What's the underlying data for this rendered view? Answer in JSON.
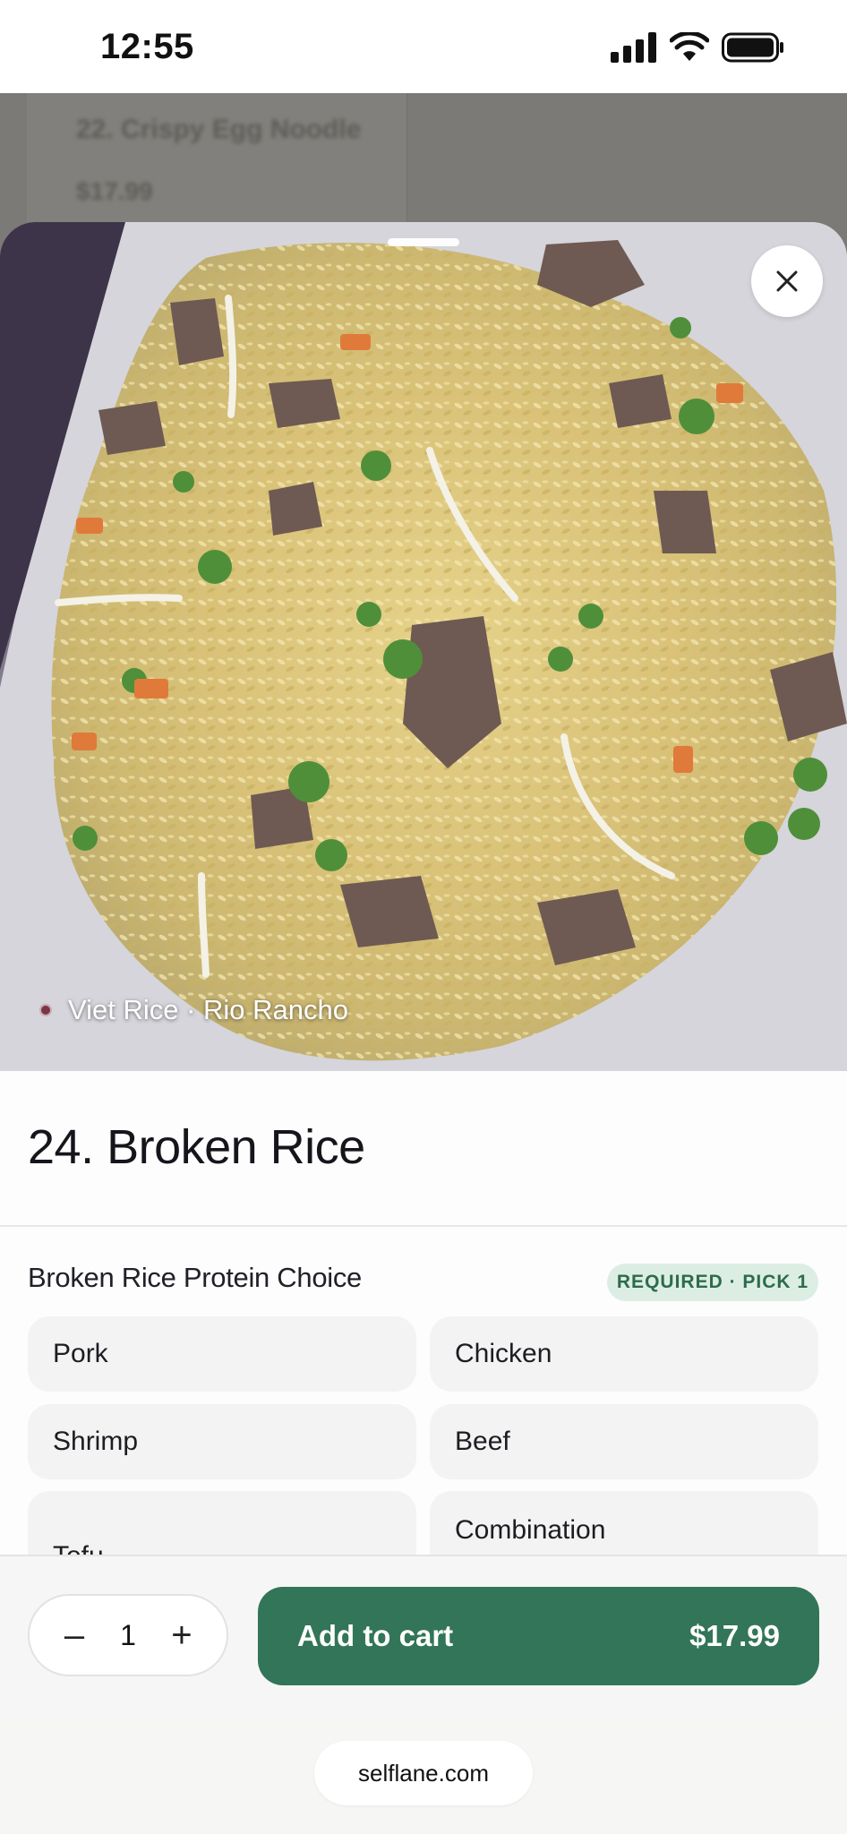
{
  "status_bar": {
    "time": "12:55"
  },
  "background_menu": {
    "item_name": "22. Crispy Egg Noodle",
    "item_price": "$17.99"
  },
  "item": {
    "hero_alt": "Broken Rice",
    "restaurant_tag": "Viet Rice · Rio Rancho",
    "title": "24. Broken Rice"
  },
  "options_group": {
    "title": "Broken Rice Protein Choice",
    "badge": "REQUIRED · PICK 1",
    "options": [
      "Pork",
      "Chicken",
      "Shrimp",
      "Beef",
      "Tofu",
      "Combination (Pork/Chicken/Shrimp/Beef)"
    ]
  },
  "cart_bar": {
    "quantity": "1",
    "minus_label": "–",
    "plus_label": "+",
    "add_label": "Add to cart",
    "price": "$17.99"
  },
  "browser": {
    "url": "selflane.com"
  },
  "colors": {
    "accent": "#327558",
    "badge_bg": "#dceee4",
    "badge_text": "#2d6b4c"
  },
  "icons": [
    "signal-icon",
    "wifi-icon",
    "battery-icon",
    "close-icon",
    "location-dot-icon"
  ]
}
